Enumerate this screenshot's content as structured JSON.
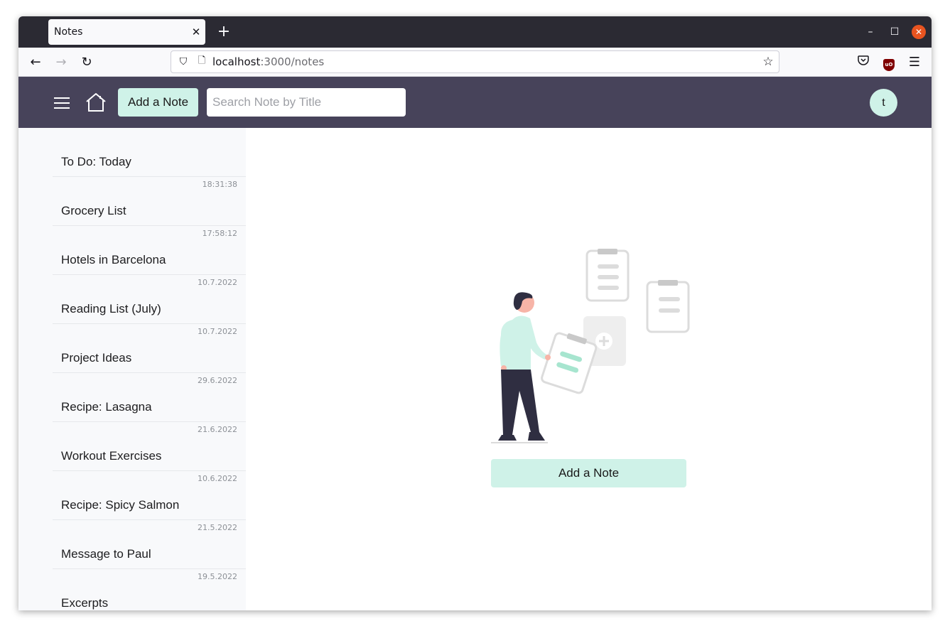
{
  "browser": {
    "tab_title": "Notes",
    "url_host": "localhost",
    "url_path": ":3000/notes"
  },
  "header": {
    "add_button_label": "Add a Note",
    "search_placeholder": "Search Note by Title",
    "avatar_initial": "t"
  },
  "sidebar": {
    "notes": [
      {
        "title": "To Do: Today",
        "date": "18:31:38"
      },
      {
        "title": "Grocery List",
        "date": "17:58:12"
      },
      {
        "title": "Hotels in Barcelona",
        "date": "10.7.2022"
      },
      {
        "title": "Reading List (July)",
        "date": "10.7.2022"
      },
      {
        "title": "Project Ideas",
        "date": "29.6.2022"
      },
      {
        "title": "Recipe: Lasagna",
        "date": "21.6.2022"
      },
      {
        "title": "Workout Exercises",
        "date": "10.6.2022"
      },
      {
        "title": "Recipe: Spicy Salmon",
        "date": "21.5.2022"
      },
      {
        "title": "Message to Paul",
        "date": "19.5.2022"
      },
      {
        "title": "Excerpts",
        "date": ""
      }
    ]
  },
  "main": {
    "add_button_label": "Add a Note"
  },
  "colors": {
    "header_bg": "#47435a",
    "accent": "#cff2e8",
    "sidebar_bg": "#f8f9fb"
  }
}
